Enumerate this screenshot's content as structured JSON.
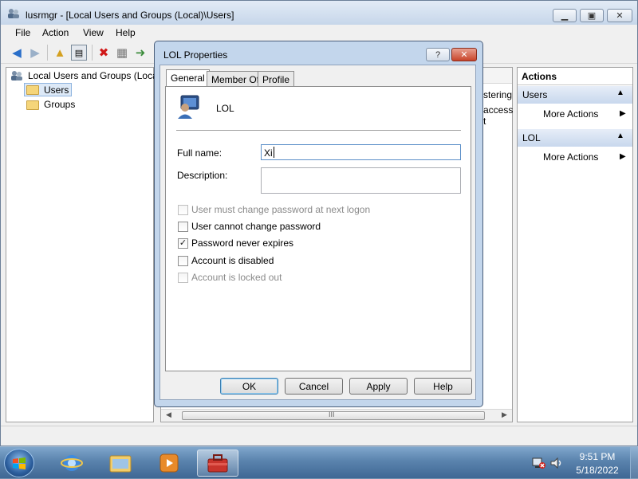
{
  "main_window": {
    "title": "lusrmgr - [Local Users and Groups (Local)\\Users]",
    "menu": [
      "File",
      "Action",
      "View",
      "Help"
    ],
    "tree": {
      "root": "Local Users and Groups (Local",
      "children": [
        "Users",
        "Groups"
      ],
      "selected": "Users"
    },
    "center_partial": [
      "stering",
      "access t"
    ],
    "actions": {
      "title": "Actions",
      "sections": [
        {
          "header": "Users",
          "items": [
            "More Actions"
          ]
        },
        {
          "header": "LOL",
          "items": [
            "More Actions"
          ]
        }
      ]
    },
    "scroll_thumb_glyph": "III"
  },
  "dialog": {
    "title": "LOL Properties",
    "help_glyph": "?",
    "close_glyph": "✕",
    "tabs": [
      "General",
      "Member Of",
      "Profile"
    ],
    "active_tab": "General",
    "user_name": "LOL",
    "fields": {
      "full_name_label": "Full name:",
      "full_name_value": "Xi",
      "description_label": "Description:",
      "description_value": ""
    },
    "checkboxes": [
      {
        "label": "User must change password at next logon",
        "checked": false,
        "enabled": false
      },
      {
        "label": "User cannot change password",
        "checked": false,
        "enabled": true
      },
      {
        "label": "Password never expires",
        "checked": true,
        "enabled": true
      },
      {
        "label": "Account is disabled",
        "checked": false,
        "enabled": true
      },
      {
        "label": "Account is locked out",
        "checked": false,
        "enabled": false
      }
    ],
    "buttons": [
      "OK",
      "Cancel",
      "Apply",
      "Help"
    ]
  },
  "taskbar": {
    "time": "9:51 PM",
    "date": "5/18/2022"
  }
}
